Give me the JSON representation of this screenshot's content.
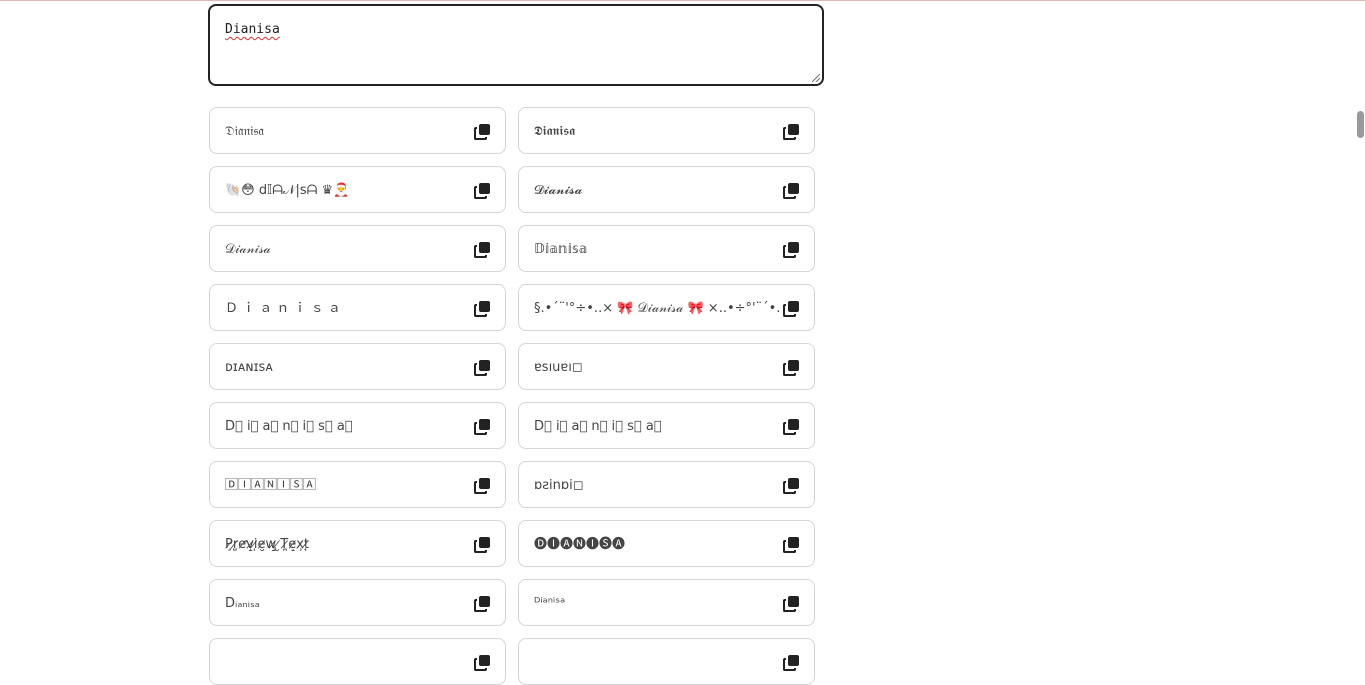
{
  "generator": {
    "input_value": "Dianisa"
  },
  "results": [
    {
      "text": "𝔇𝔦𝔞𝔫𝔦𝔰𝔞"
    },
    {
      "text": "𝕯𝖎𝖆𝖓𝖎𝖘𝖆"
    },
    {
      "text": "🐚😳  d𝕀ᗩ𝒩|sᗩ  ♛🎅"
    },
    {
      "text": "𝓓𝓲𝓪𝓷𝓲𝓼𝓪"
    },
    {
      "text": "𝒟𝒾𝒶𝓃𝒾𝓈𝒶"
    },
    {
      "text": "𝔻𝕚𝕒𝕟𝕚𝕤𝕒"
    },
    {
      "text": "Ｄ ｉ ａ ｎ ｉ ｓ ａ"
    },
    {
      "text": "§.•´¨'°÷•..×  🎀  𝒟𝒾𝒶𝓃𝒾𝓈𝒶  🎀  ×..•÷°'¨´•.§"
    },
    {
      "text": "ᴅɪᴀɴɪꜱᴀ"
    },
    {
      "text": "ɐsıuɐı◻"
    },
    {
      "text": "D⃞  i⃞  a⃞  n⃞  i⃞  s⃞  a⃞"
    },
    {
      "text": "D⃞  i⃞  a⃞  n⃞  i⃞  s⃞  a⃞"
    },
    {
      "text": "🄳🄸🄰🄽🄸🅂🄰"
    },
    {
      "text": "ɒƨinɒi◻"
    },
    {
      "text": "P̷̧r̷̺e̷̛v̷̝i̷̩e̷̮w̷̡ ̷̮T̷̪e̷̝x̷̹t̷̘"
    },
    {
      "text": "🅓🅘🅐🅝🅘🅢🅐"
    },
    {
      "text": "Dᵢₐₙᵢₛₐ"
    },
    {
      "text": "ᴰⁱᵃⁿⁱˢᵃ"
    },
    {
      "text": ""
    },
    {
      "text": ""
    }
  ],
  "icons": {
    "copy": "copy-icon"
  }
}
